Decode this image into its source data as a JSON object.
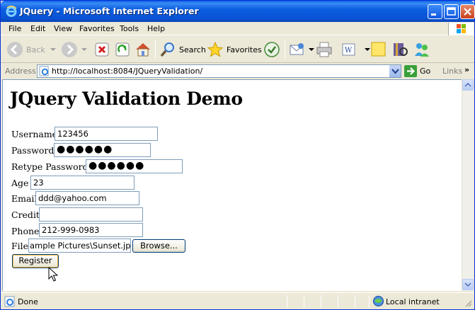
{
  "window": {
    "title": "JQuery - Microsoft Internet Explorer"
  },
  "menu": [
    "File",
    "Edit",
    "View",
    "Favorites",
    "Tools",
    "Help"
  ],
  "toolbar": {
    "back": "Back",
    "search": "Search",
    "favorites": "Favorites"
  },
  "address": {
    "label": "Address",
    "url": "http://localhost:8084/JQueryValidation/",
    "go": "Go",
    "links": "Links"
  },
  "page": {
    "title": "JQuery Validation Demo",
    "fields": {
      "username": {
        "label": "Username",
        "value": "123456"
      },
      "password": {
        "label": "Password",
        "value": "●●●●●●"
      },
      "retype": {
        "label": "Retype Password",
        "value": "●●●●●●"
      },
      "age": {
        "label": "Age",
        "value": "23"
      },
      "email": {
        "label": "Email",
        "value": "ddd@yahoo.com"
      },
      "credit": {
        "label": "Credit",
        "value": ""
      },
      "phone": {
        "label": "Phone",
        "value": "212-999-0983"
      },
      "file": {
        "label": "File",
        "value": "ample Pictures\\Sunset.jpg",
        "browse": "Browse..."
      }
    },
    "register": "Register"
  },
  "status": {
    "text": "Done",
    "zone": "Local intranet"
  }
}
